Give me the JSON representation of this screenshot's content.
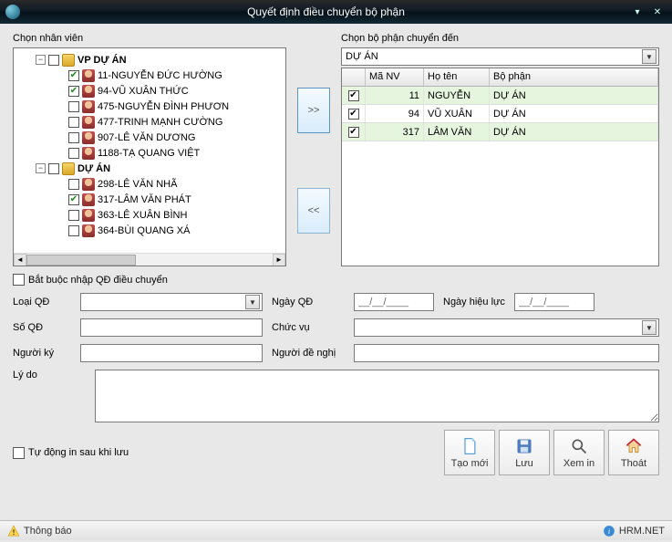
{
  "window": {
    "title": "Quyết định điều chuyển bộ phận",
    "minimize_glyph": "▾",
    "close_glyph": "✕"
  },
  "left_panel": {
    "label": "Chọn nhân viên",
    "groups": [
      {
        "name": "VP DỰ ÁN",
        "checked": false,
        "items": [
          {
            "text": "11-NGUYỄN ĐỨC HƯỜNG",
            "checked": true
          },
          {
            "text": "94-VŨ XUÂN THỨC",
            "checked": true
          },
          {
            "text": "475-NGUYỄN ĐÌNH PHƯƠN",
            "checked": false
          },
          {
            "text": "477-TRINH MẠNH CƯỜNG",
            "checked": false
          },
          {
            "text": "907-LÊ VĂN DƯƠNG",
            "checked": false
          },
          {
            "text": "1188-TẠ QUANG VIỆT",
            "checked": false
          }
        ]
      },
      {
        "name": "DỰ ÁN",
        "checked": false,
        "items": [
          {
            "text": "298-LÊ VĂN NHÃ",
            "checked": false
          },
          {
            "text": "317-LÂM VĂN PHÁT",
            "checked": true
          },
          {
            "text": "363-LÊ XUÂN BÌNH",
            "checked": false
          },
          {
            "text": "364-BÙI QUANG XÁ",
            "checked": false
          }
        ]
      }
    ]
  },
  "mid": {
    "add_glyph": ">>",
    "remove_glyph": "<<"
  },
  "right_panel": {
    "label": "Chọn bộ phận chuyển đến",
    "combo_value": "DỰ ÁN",
    "grid": {
      "headers": {
        "c0": "",
        "c1": "Mã NV",
        "c2": "Họ tên",
        "c3": "Bộ phận"
      },
      "rows": [
        {
          "id": "11",
          "name": "NGUYỄN",
          "dept": "DỰ ÁN"
        },
        {
          "id": "94",
          "name": "VŨ XUÂN",
          "dept": "DỰ ÁN"
        },
        {
          "id": "317",
          "name": "LÂM VĂN",
          "dept": "DỰ ÁN"
        }
      ]
    }
  },
  "form": {
    "mandatory_check_label": "Bắt buộc nhập QĐ điều chuyển",
    "labels": {
      "loai_qd": "Loại QĐ",
      "so_qd": "Số QĐ",
      "nguoi_ky": "Người ký",
      "ngay_qd": "Ngày QĐ",
      "ngay_hieu_luc": "Ngày hiệu lực",
      "chuc_vu": "Chức vụ",
      "nguoi_de_nghi": "Người đề nghị",
      "ly_do": "Lý do"
    },
    "date_placeholder": "__/__/____",
    "auto_print_label": "Tự động in sau khi lưu"
  },
  "buttons": {
    "tao_moi": "Tạo mới",
    "luu": "Lưu",
    "xem_in": "Xem in",
    "thoat": "Thoát"
  },
  "statusbar": {
    "left": "Thông báo",
    "right": "HRM.NET"
  }
}
